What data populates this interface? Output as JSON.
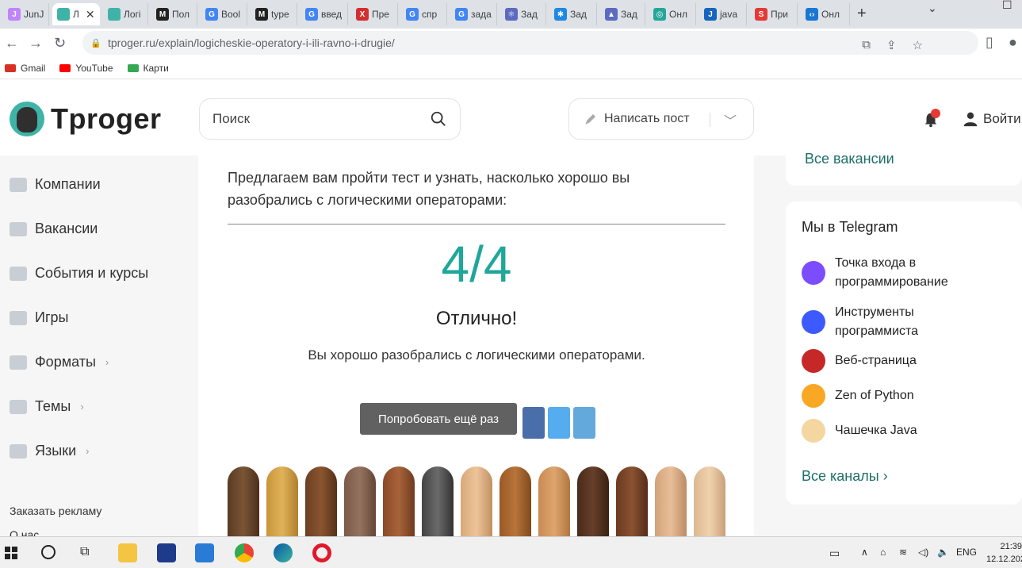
{
  "browser": {
    "tabs": [
      {
        "label": "JunJ",
        "fav_color": "#c084fc",
        "fav_char": "J"
      },
      {
        "label": "Л",
        "fav_color": "#3fb3a8",
        "fav_char": "",
        "active": true
      },
      {
        "label": "Логі",
        "fav_color": "#3fb3a8",
        "fav_char": ""
      },
      {
        "label": "Пол",
        "fav_color": "#222222",
        "fav_char": "M"
      },
      {
        "label": "Bool",
        "fav_color": "#4285f4",
        "fav_char": "G"
      },
      {
        "label": "type",
        "fav_color": "#222222",
        "fav_char": "M"
      },
      {
        "label": "введ",
        "fav_color": "#4285f4",
        "fav_char": "G"
      },
      {
        "label": "Пре",
        "fav_color": "#d32f2f",
        "fav_char": "Х"
      },
      {
        "label": "спр",
        "fav_color": "#4285f4",
        "fav_char": "G"
      },
      {
        "label": "зада",
        "fav_color": "#4285f4",
        "fav_char": "G"
      },
      {
        "label": "Зад",
        "fav_color": "#5c6bc0",
        "fav_char": "⚛"
      },
      {
        "label": "Зад",
        "fav_color": "#1e88e5",
        "fav_char": "✱"
      },
      {
        "label": "Зад",
        "fav_color": "#5c6bc0",
        "fav_char": "▲"
      },
      {
        "label": "Онл",
        "fav_color": "#26a69a",
        "fav_char": "◎"
      },
      {
        "label": "java",
        "fav_color": "#1565c0",
        "fav_char": "J"
      },
      {
        "label": "При",
        "fav_color": "#e53935",
        "fav_char": "S"
      },
      {
        "label": "Онл",
        "fav_color": "#1976d2",
        "fav_char": "‹›"
      }
    ],
    "url": "tproger.ru/explain/logicheskie-operatory-i-ili-ravno-i-drugie/",
    "bookmarks": [
      {
        "label": "Gmail",
        "color": "#d93025"
      },
      {
        "label": "YouTube",
        "color": "#ff0000"
      },
      {
        "label": "Карти",
        "color": "#34a853"
      }
    ]
  },
  "site": {
    "logo_text": "Tproger",
    "search_placeholder": "Поиск",
    "write_post_label": "Написать пост",
    "login_label": "Войти",
    "accent": "#1ea79a"
  },
  "sidebar": {
    "items": [
      {
        "label": "Компании",
        "has_arrow": false
      },
      {
        "label": "Вакансии",
        "has_arrow": false
      },
      {
        "label": "События и курсы",
        "has_arrow": false
      },
      {
        "label": "Игры",
        "has_arrow": false
      },
      {
        "label": "Форматы",
        "has_arrow": true
      },
      {
        "label": "Темы",
        "has_arrow": true
      },
      {
        "label": "Языки",
        "has_arrow": true
      }
    ],
    "advertise": "Заказать рекламу",
    "about": "О нас"
  },
  "quiz": {
    "intro": "Предлагаем вам пройти тест и узнать, насколько хорошо вы разобрались с логическими операторами:",
    "score": "4/4",
    "verdict": "Отлично!",
    "result": "Вы хорошо разобрались с логическими операторами.",
    "retry_label": "Попробовать ещё раз"
  },
  "right": {
    "all_vacancies": "Все вакансии",
    "telegram_title": "Мы в Telegram",
    "channels": [
      {
        "label": "Точка входа в программирование",
        "color": "#7c4dff"
      },
      {
        "label": "Инструменты программиста",
        "color": "#3d5afe"
      },
      {
        "label": "Веб-страница",
        "color": "#c62828"
      },
      {
        "label": "Zen of Python",
        "color": "#f9a825"
      },
      {
        "label": "Чашечка Java",
        "color": "#f4d6a0"
      }
    ],
    "all_channels": "Все каналы"
  },
  "taskbar": {
    "lang": "ENG",
    "time": "21:39",
    "date": "12.12.202"
  }
}
